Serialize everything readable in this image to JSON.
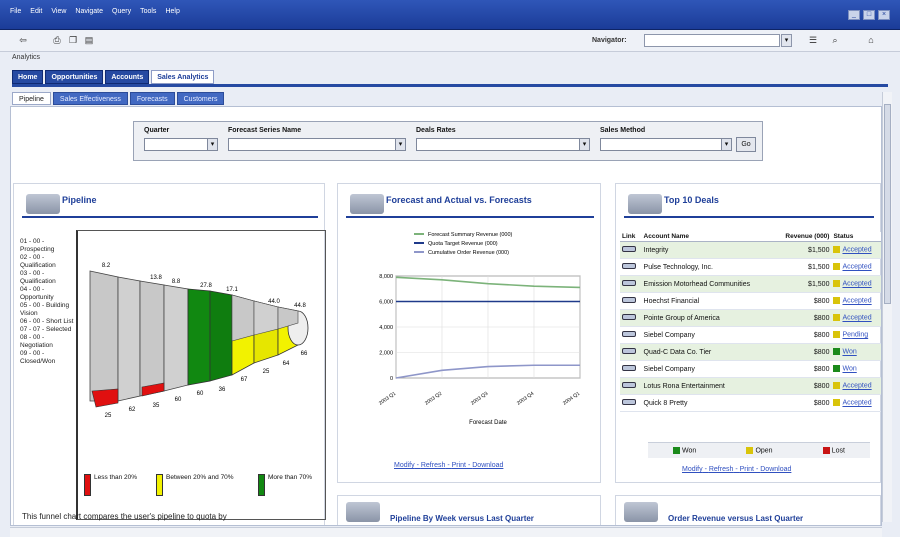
{
  "window": {
    "menus": [
      "File",
      "Edit",
      "View",
      "Navigate",
      "Query",
      "Tools",
      "Help"
    ]
  },
  "toolbar": {
    "navigator_label": "Navigator:"
  },
  "breadcrumb": "Analytics",
  "app_tabs": [
    "Home",
    "Opportunities",
    "Accounts",
    "Sales Analytics"
  ],
  "sub_tabs": [
    "Pipeline",
    "Sales Effectiveness",
    "Forecasts",
    "Customers"
  ],
  "filters": {
    "fields": [
      "Quarter",
      "Forecast Series Name",
      "Deals Rates",
      "Sales Method"
    ],
    "go_label": "Go"
  },
  "pipeline": {
    "title": "Pipeline",
    "stages": [
      "01 - 00 - Prospecting",
      "02 - 00 - Qualification",
      "03 - 00 - Qualification",
      "04 - 00 - Opportunity",
      "05 - 00 - Building Vision",
      "06 - 00 - Short List",
      "07 - 07 - Selected",
      "08 - 00 - Negotiation",
      "09 - 00 - Closed/Won"
    ],
    "top_labels": [
      "8.2",
      "13.8",
      "8.8",
      "27.8",
      "17.1",
      "44.0",
      "44.8"
    ],
    "bottom_labels": [
      "25",
      "62",
      "35",
      "60",
      "60",
      "36",
      "67",
      "25",
      "64",
      "66"
    ],
    "legend": [
      {
        "label": "Less than 20%",
        "color": "#e01010"
      },
      {
        "label": "Between 20% and 70%",
        "color": "#f2f200"
      },
      {
        "label": "More than 70%",
        "color": "#118811"
      }
    ],
    "description": "This funnel chart compares the user's pipeline to quota by"
  },
  "forecast": {
    "title": "Forecast and Actual vs. Forecasts",
    "legend": [
      "Forecast Summary Revenue (000)",
      "Quota Target Revenue (000)",
      "Cumulative Order Revenue (000)"
    ],
    "y_ticks": [
      "8,000",
      "6,000",
      "4,000",
      "2,000",
      "0"
    ],
    "x_ticks": [
      "2003 Q1",
      "2003 Q2",
      "2003 Q3",
      "2003 Q4",
      "2004 Q1"
    ],
    "xlabel": "Forecast Date",
    "links": [
      "Modify",
      "Refresh",
      "Print",
      "Download"
    ]
  },
  "top_deals": {
    "title": "Top 10 Deals",
    "headers": {
      "link": "Link",
      "account": "Account Name",
      "revenue": "Revenue (000)",
      "status": "Status"
    },
    "rows": [
      {
        "account": "Integrity",
        "revenue": "$1,500",
        "status": "Accepted",
        "status_color": "#d9c40a"
      },
      {
        "account": "Pulse Technology, Inc.",
        "revenue": "$1,500",
        "status": "Accepted",
        "status_color": "#d9c40a"
      },
      {
        "account": "Emission Motorhead Communities",
        "revenue": "$1,500",
        "status": "Accepted",
        "status_color": "#d9c40a"
      },
      {
        "account": "Hoechst Financial",
        "revenue": "$800",
        "status": "Accepted",
        "status_color": "#d9c40a"
      },
      {
        "account": "Pointe Group of America",
        "revenue": "$800",
        "status": "Accepted",
        "status_color": "#d9c40a"
      },
      {
        "account": "Siebel Company",
        "revenue": "$800",
        "status": "Pending",
        "status_color": "#d9c40a"
      },
      {
        "account": "Quad-C Data Co. Tier",
        "revenue": "$800",
        "status": "Won",
        "status_color": "#1b8a1b"
      },
      {
        "account": "Siebel Company",
        "revenue": "$800",
        "status": "Won",
        "status_color": "#1b8a1b"
      },
      {
        "account": "Lotus Rona Entertainment",
        "revenue": "$800",
        "status": "Accepted",
        "status_color": "#d9c40a"
      },
      {
        "account": "Quick 8 Pretty",
        "revenue": "$800",
        "status": "Accepted",
        "status_color": "#d9c40a"
      }
    ],
    "actions": [
      "Won",
      "Open",
      "Lost"
    ],
    "links": [
      "Modify",
      "Refresh",
      "Print",
      "Download"
    ]
  },
  "lower_panels": [
    "Pipeline By Week versus Last Quarter",
    "Order Revenue versus Last Quarter"
  ],
  "chart_data": {
    "type": "line",
    "title": "Forecast and Actual vs. Forecasts",
    "x": [
      "2003 Q1",
      "2003 Q2",
      "2003 Q3",
      "2003 Q4",
      "2004 Q1"
    ],
    "series": [
      {
        "name": "Forecast Summary Revenue (000)",
        "values": [
          7900,
          7700,
          7400,
          7200,
          7100
        ],
        "color": "#7cb37a"
      },
      {
        "name": "Quota Target Revenue (000)",
        "values": [
          6000,
          6000,
          6000,
          6000,
          6000
        ],
        "color": "#1f3a8a"
      },
      {
        "name": "Cumulative Order Revenue (000)",
        "values": [
          0,
          600,
          900,
          1000,
          1000
        ],
        "color": "#8e96c9"
      }
    ],
    "xlabel": "Forecast Date",
    "ylabel": "",
    "ylim": [
      0,
      8000
    ],
    "grid": true,
    "legend": "top"
  }
}
